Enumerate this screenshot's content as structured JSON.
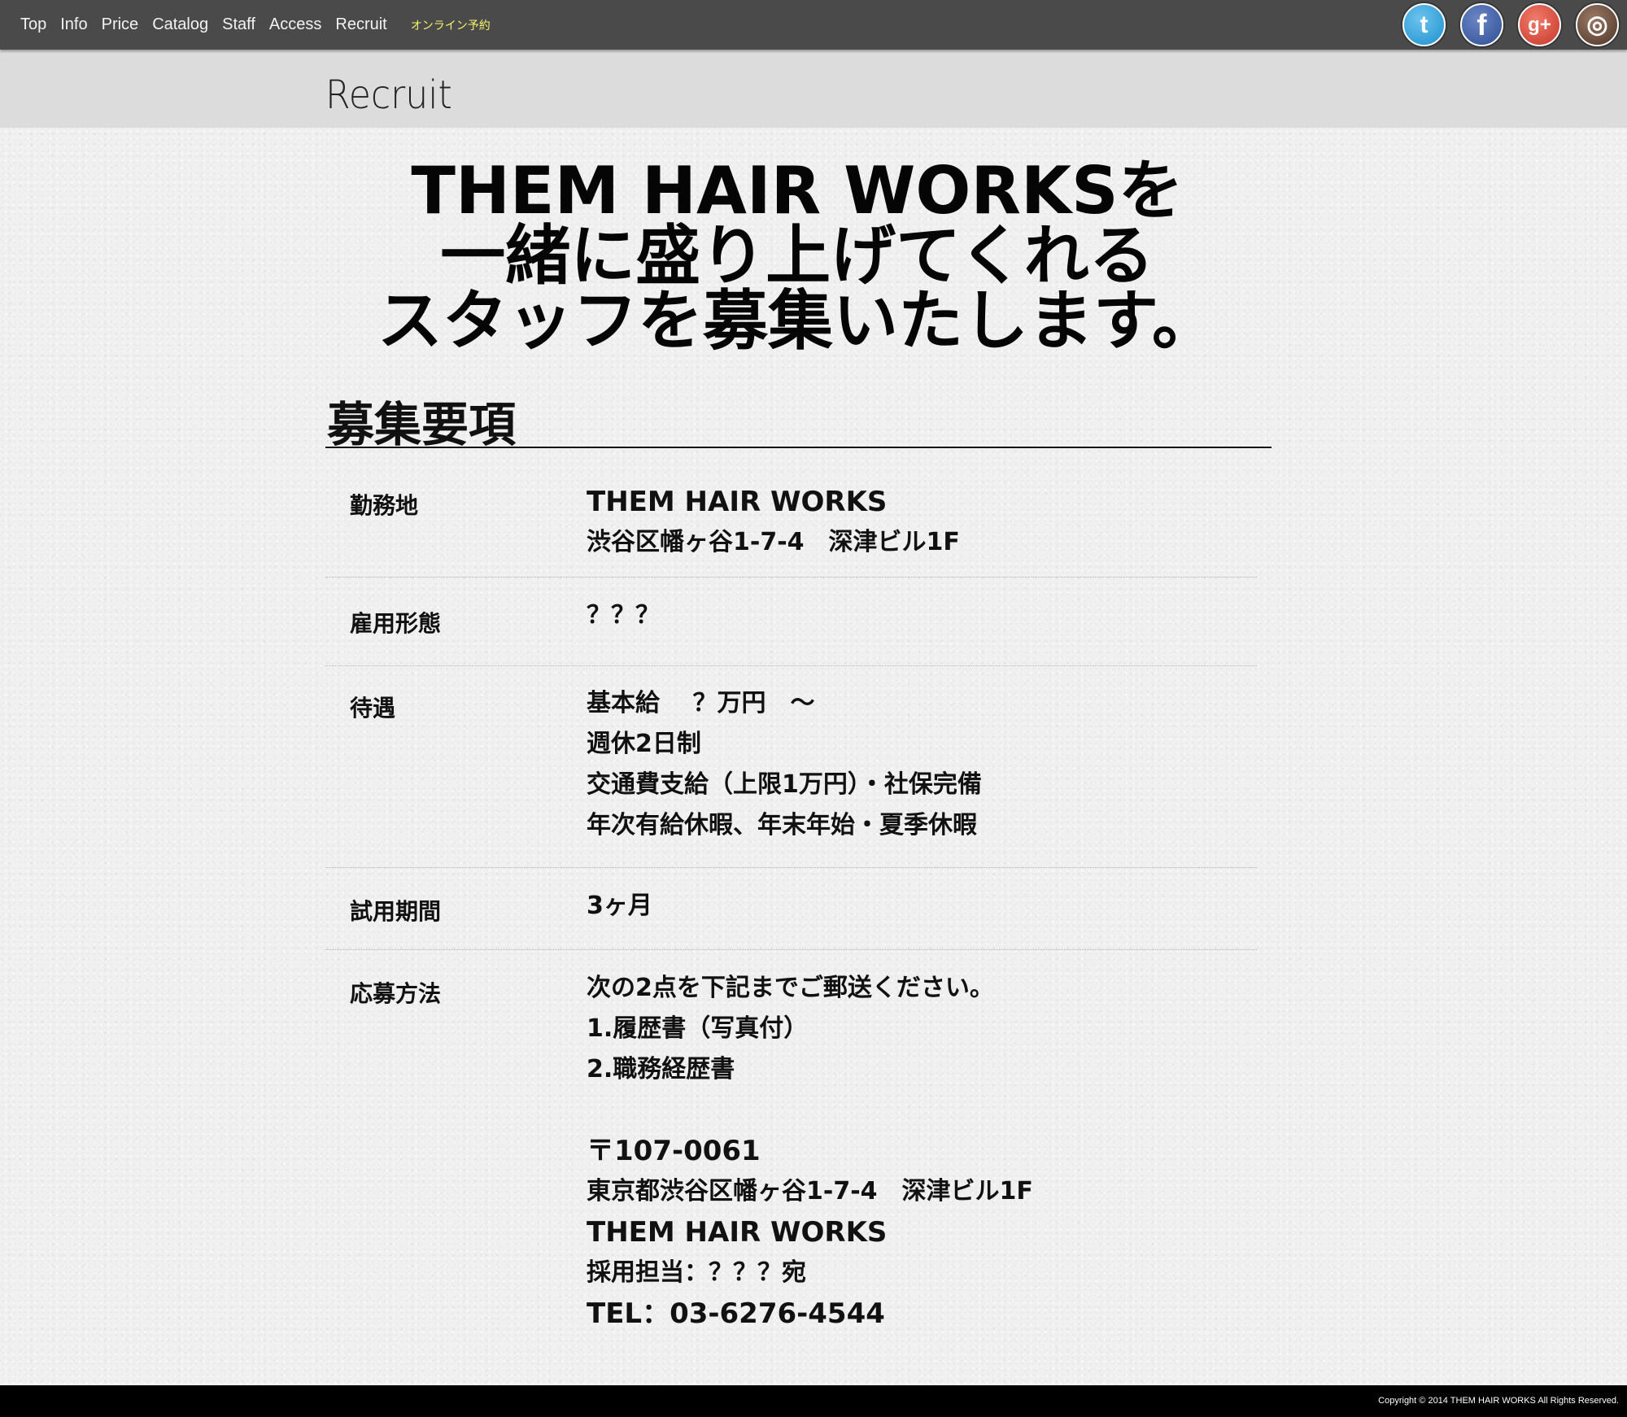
{
  "nav": {
    "items": [
      "Top",
      "Info",
      "Price",
      "Catalog",
      "Staff",
      "Access",
      "Recruit"
    ],
    "online_booking": "オンライン予約"
  },
  "social": {
    "twitter_glyph": "t",
    "facebook_glyph": "f",
    "gplus_glyph": "g+",
    "instagram_glyph": "◎"
  },
  "page_title": "Recruit",
  "headline": [
    "THEM HAIR WORKSを",
    "一緒に盛り上げてくれる",
    "スタッフを募集いたします。"
  ],
  "section_title": "募集要項",
  "rows": [
    {
      "label": "勤務地",
      "lines": [
        "THEM HAIR WORKS",
        "渋谷区幡ヶ谷1-7-4　深津ビル1F"
      ]
    },
    {
      "label": "雇用形態",
      "lines": [
        "？？？"
      ]
    },
    {
      "label": "待遇",
      "lines": [
        "基本給　 ？万円　～",
        "週休2日制",
        "交通費支給（上限1万円）・社保完備",
        "年次有給休暇、年末年始・夏季休暇"
      ]
    },
    {
      "label": "試用期間",
      "lines": [
        "3ヶ月"
      ]
    },
    {
      "label": "応募方法",
      "lines": [
        "次の2点を下記までご郵送ください。",
        "1.履歴書（写真付）",
        "2.職務経歴書",
        "",
        "〒107-0061",
        "東京都渋谷区幡ヶ谷1-7-4　深津ビル1F",
        "THEM HAIR WORKS",
        "採用担当：？？？宛",
        "TEL：03-6276-4544"
      ]
    }
  ],
  "footer": "Copyright © 2014  THEM HAIR WORKS All Rights Reserved."
}
